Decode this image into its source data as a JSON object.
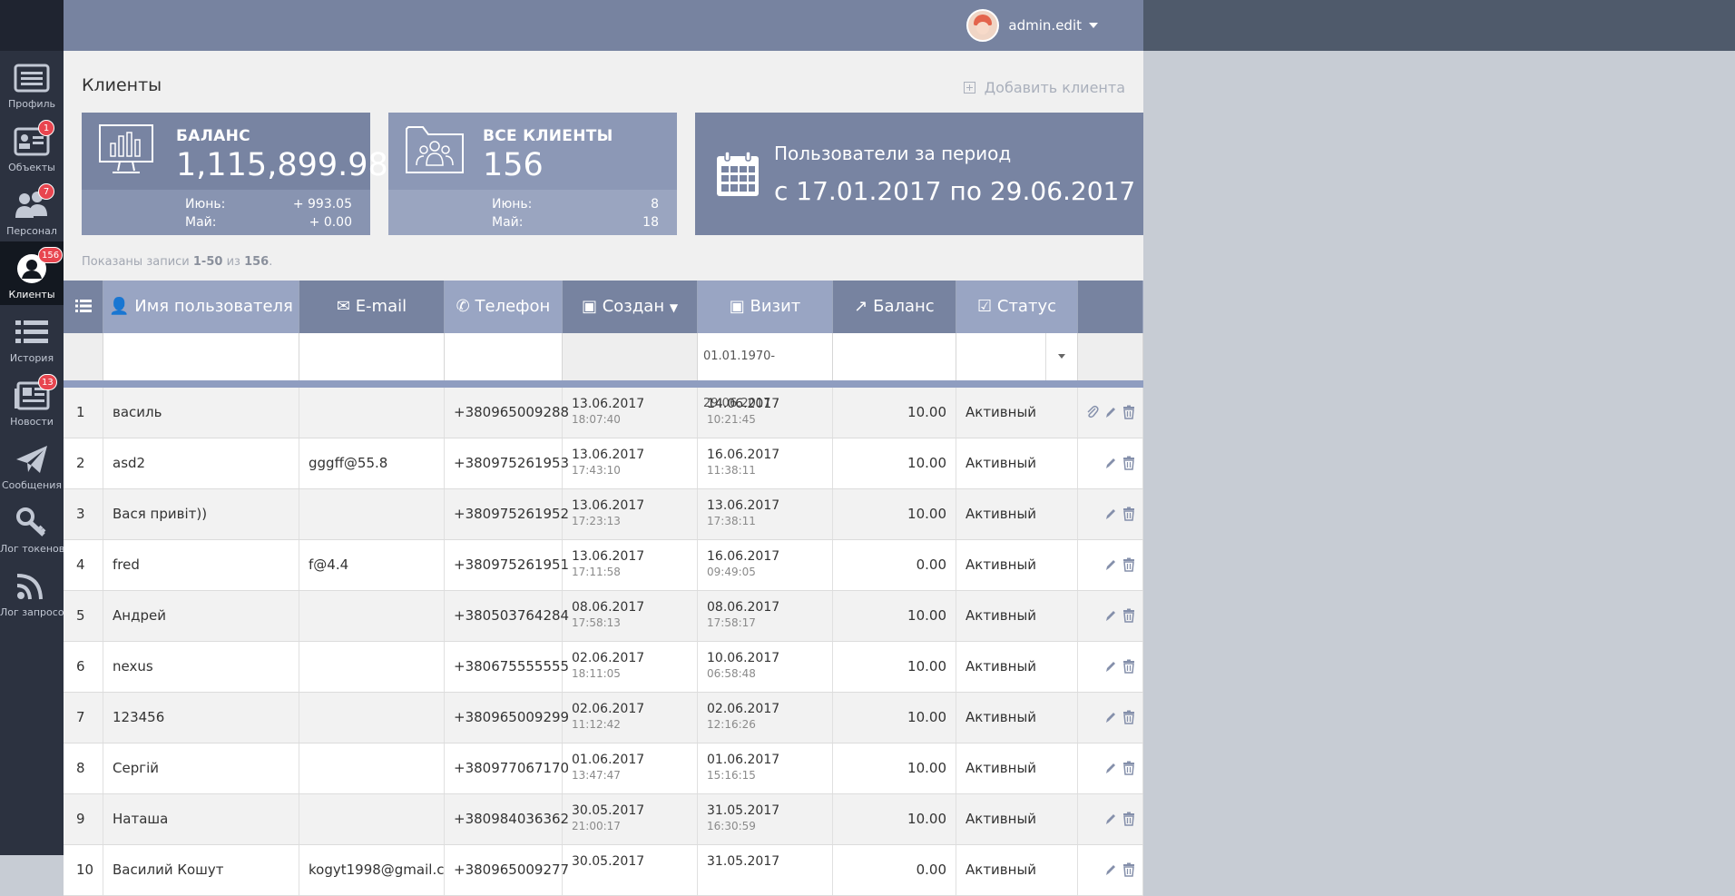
{
  "sidebar": {
    "items": [
      {
        "label": "Профиль",
        "icon": "profile-icon",
        "badge": ""
      },
      {
        "label": "Объекты",
        "icon": "objects-icon",
        "badge": "1"
      },
      {
        "label": "Персонал",
        "icon": "staff-icon",
        "badge": "7"
      },
      {
        "label": "Клиенты",
        "icon": "clients-icon",
        "badge": "156"
      },
      {
        "label": "История",
        "icon": "history-icon",
        "badge": ""
      },
      {
        "label": "Новости",
        "icon": "news-icon",
        "badge": "13"
      },
      {
        "label": "Сообщения",
        "icon": "paper-plane-icon",
        "badge": ""
      },
      {
        "label": "Лог токенов",
        "icon": "key-icon",
        "badge": ""
      },
      {
        "label": "Лог запросов",
        "icon": "rss-icon",
        "badge": ""
      }
    ]
  },
  "header": {
    "user": "admin.edit"
  },
  "page": {
    "title": "Клиенты",
    "add_label": "Добавить клиента"
  },
  "cards": {
    "balance": {
      "caption": "БАЛАНС",
      "value": "1,115,899.98",
      "row1_label": "Июнь:",
      "row1_value": "+ 993.05",
      "row2_label": "Май:",
      "row2_value": "+ 0.00"
    },
    "clients": {
      "caption": "ВСЕ КЛИЕНТЫ",
      "value": "156",
      "row1_label": "Июнь:",
      "row1_value": "8",
      "row2_label": "Май:",
      "row2_value": "18"
    },
    "period": {
      "caption": "Пользователи за период",
      "range": "с 17.01.2017 по 29.06.2017"
    }
  },
  "records": {
    "prefix": "Показаны записи ",
    "range": "1-50",
    "mid": " из ",
    "total": "156",
    "suffix": "."
  },
  "table": {
    "headers": {
      "name": "Имя пользователя",
      "email": "E-mail",
      "phone": "Телефон",
      "created": "Создан",
      "visit": "Визит",
      "balance": "Баланс",
      "status": "Статус"
    },
    "filter_visit": "01.01.1970-29.06.2017",
    "rows": [
      {
        "n": "1",
        "name": "василь",
        "email": "",
        "phone": "+380965009288",
        "created_d": "13.06.2017",
        "created_t": "18:07:40",
        "visit_d": "14.06.2017",
        "visit_t": "10:21:45",
        "balance": "10.00",
        "status": "Активный"
      },
      {
        "n": "2",
        "name": "asd2",
        "email": "gggff@55.8",
        "phone": "+380975261953",
        "created_d": "13.06.2017",
        "created_t": "17:43:10",
        "visit_d": "16.06.2017",
        "visit_t": "11:38:11",
        "balance": "10.00",
        "status": "Активный"
      },
      {
        "n": "3",
        "name": "Вася привіт))",
        "email": "",
        "phone": "+380975261952",
        "created_d": "13.06.2017",
        "created_t": "17:23:13",
        "visit_d": "13.06.2017",
        "visit_t": "17:38:11",
        "balance": "10.00",
        "status": "Активный"
      },
      {
        "n": "4",
        "name": "fred",
        "email": "f@4.4",
        "phone": "+380975261951",
        "created_d": "13.06.2017",
        "created_t": "17:11:58",
        "visit_d": "16.06.2017",
        "visit_t": "09:49:05",
        "balance": "0.00",
        "status": "Активный"
      },
      {
        "n": "5",
        "name": "Андрей",
        "email": "",
        "phone": "+380503764284",
        "created_d": "08.06.2017",
        "created_t": "17:58:13",
        "visit_d": "08.06.2017",
        "visit_t": "17:58:17",
        "balance": "10.00",
        "status": "Активный"
      },
      {
        "n": "6",
        "name": "nexus",
        "email": "",
        "phone": "+380675555555",
        "created_d": "02.06.2017",
        "created_t": "18:11:05",
        "visit_d": "10.06.2017",
        "visit_t": "06:58:48",
        "balance": "10.00",
        "status": "Активный"
      },
      {
        "n": "7",
        "name": "123456",
        "email": "",
        "phone": "+380965009299",
        "created_d": "02.06.2017",
        "created_t": "11:12:42",
        "visit_d": "02.06.2017",
        "visit_t": "12:16:26",
        "balance": "10.00",
        "status": "Активный"
      },
      {
        "n": "8",
        "name": "Сергій",
        "email": "",
        "phone": "+380977067170",
        "created_d": "01.06.2017",
        "created_t": "13:47:47",
        "visit_d": "01.06.2017",
        "visit_t": "15:16:15",
        "balance": "10.00",
        "status": "Активный"
      },
      {
        "n": "9",
        "name": "Наташа",
        "email": "",
        "phone": "+380984036362",
        "created_d": "30.05.2017",
        "created_t": "21:00:17",
        "visit_d": "31.05.2017",
        "visit_t": "16:30:59",
        "balance": "10.00",
        "status": "Активный"
      },
      {
        "n": "10",
        "name": "Василий Кошут",
        "email": "kogyt1998@gmail.c",
        "phone": "+380965009277",
        "created_d": "30.05.2017",
        "created_t": "",
        "visit_d": "31.05.2017",
        "visit_t": "",
        "balance": "0.00",
        "status": "Активный"
      }
    ]
  }
}
